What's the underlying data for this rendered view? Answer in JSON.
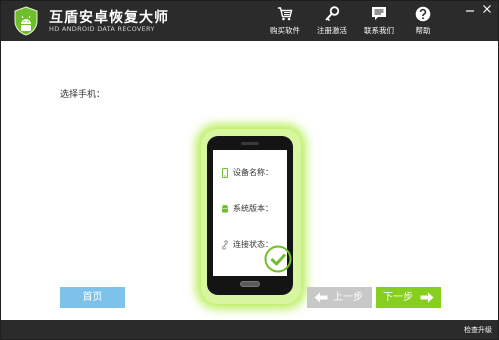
{
  "app": {
    "title": "互盾安卓恢复大师",
    "subtitle": "HD ANDROID DATA RECOVERY"
  },
  "nav": [
    {
      "icon": "cart-icon",
      "label": "购买软件"
    },
    {
      "icon": "key-icon",
      "label": "注册激活"
    },
    {
      "icon": "chat-icon",
      "label": "联系我们"
    },
    {
      "icon": "help-icon",
      "label": "帮助"
    }
  ],
  "main": {
    "select_label": "选择手机：",
    "device": {
      "name_label": "设备名称：",
      "version_label": "系统版本：",
      "status_label": "连接状态："
    }
  },
  "buttons": {
    "home": "首页",
    "prev": "上一步",
    "next": "下一步"
  },
  "footer": {
    "update": "检查升级"
  },
  "colors": {
    "titlebar": "#2b2b2b",
    "accent_green": "#86cf1f",
    "accent_blue": "#7cc2ea",
    "disabled_gray": "#c8c8c8",
    "phone_glow": "#b9ee5a"
  }
}
